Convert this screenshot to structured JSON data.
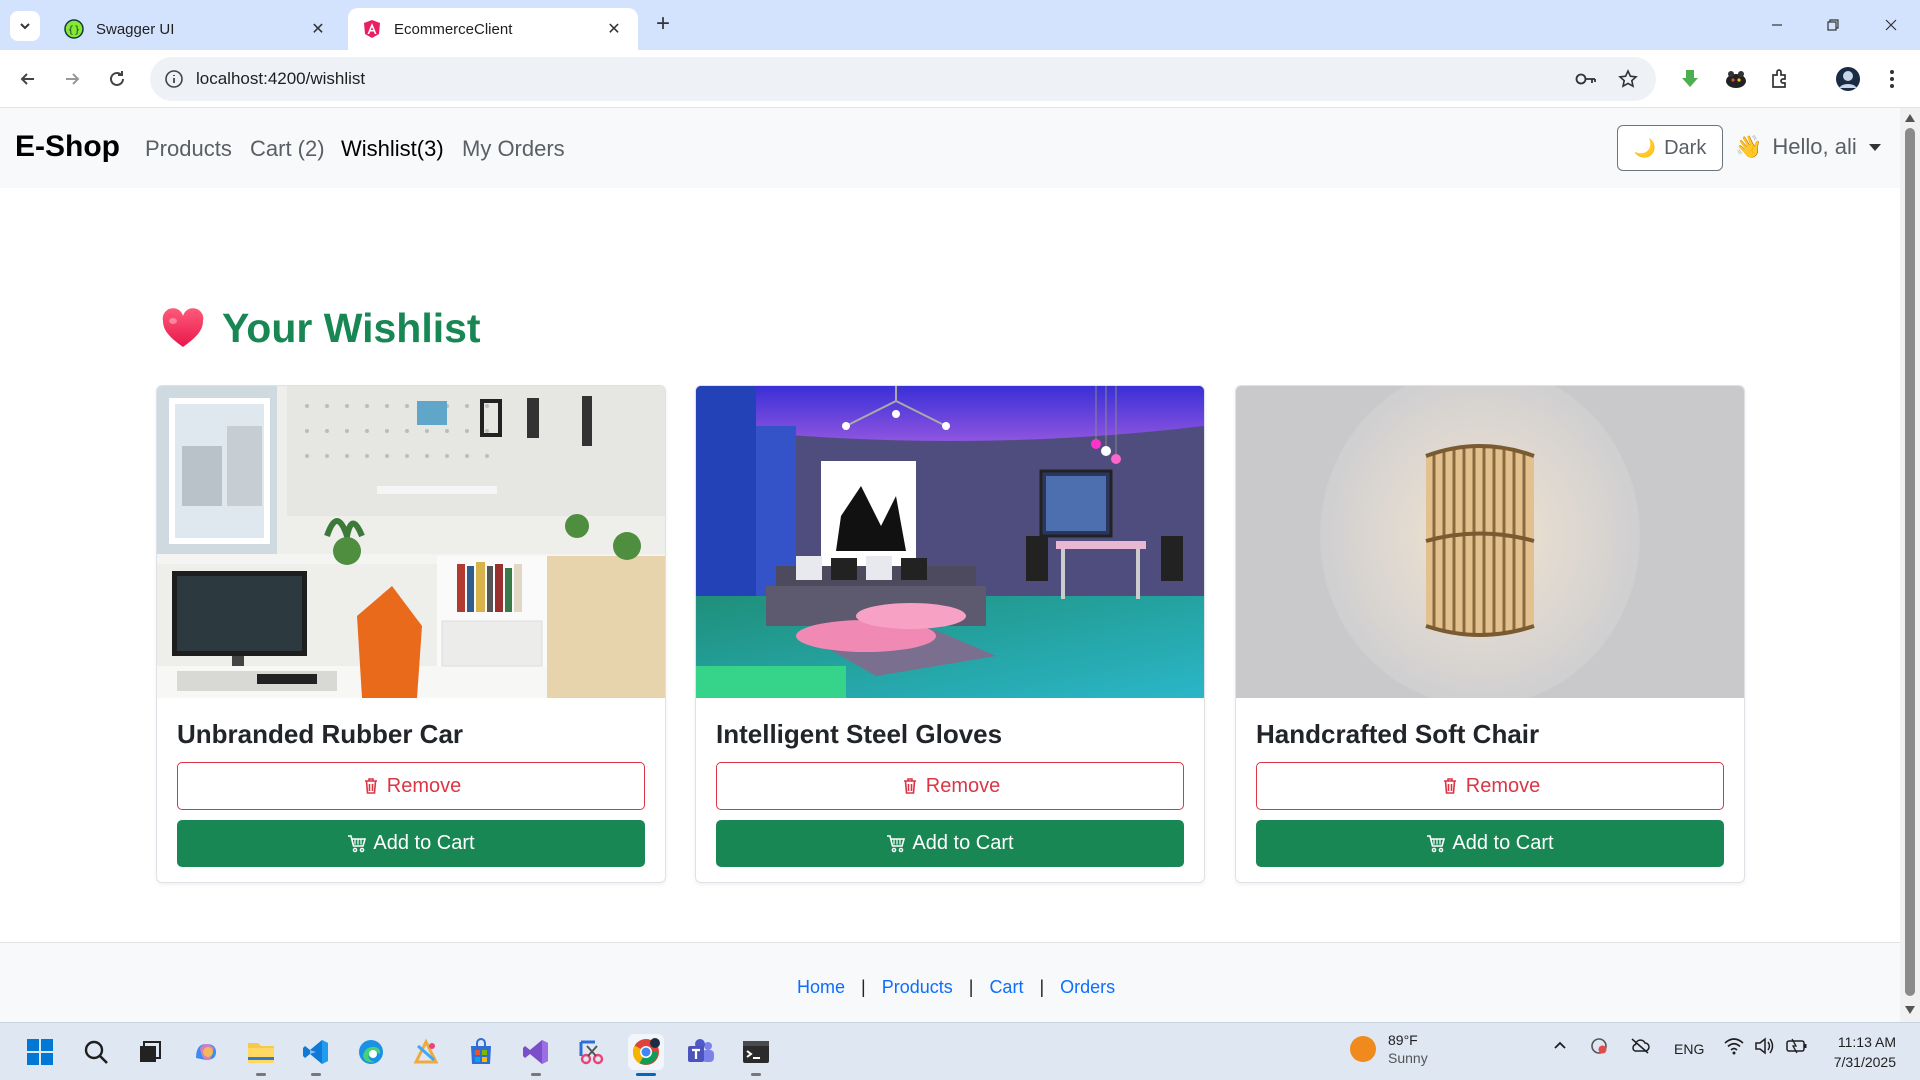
{
  "browser": {
    "tabs": [
      {
        "title": "Swagger UI",
        "active": false
      },
      {
        "title": "EcommerceClient",
        "active": true
      }
    ],
    "url": "localhost:4200/wishlist"
  },
  "navbar": {
    "brand": "E-Shop",
    "links": [
      "Products",
      "Cart (2)",
      "Wishlist(3)",
      "My Orders"
    ],
    "theme_label": "Dark",
    "user_greeting": "Hello, ali"
  },
  "wishlist": {
    "title": "Your Wishlist",
    "items": [
      {
        "name": "Unbranded Rubber Car",
        "remove_label": "Remove",
        "cart_label": "Add to Cart"
      },
      {
        "name": "Intelligent Steel Gloves",
        "remove_label": "Remove",
        "cart_label": "Add to Cart"
      },
      {
        "name": "Handcrafted Soft Chair",
        "remove_label": "Remove",
        "cart_label": "Add to Cart"
      }
    ]
  },
  "footer": {
    "links": [
      "Home",
      "Products",
      "Cart",
      "Orders"
    ]
  },
  "taskbar": {
    "weather_temp": "89°F",
    "weather_desc": "Sunny",
    "language": "ENG",
    "time": "11:13 AM",
    "date": "7/31/2025"
  },
  "colors": {
    "accent": "#198754",
    "danger": "#dc3545",
    "link": "#0d6efd"
  }
}
